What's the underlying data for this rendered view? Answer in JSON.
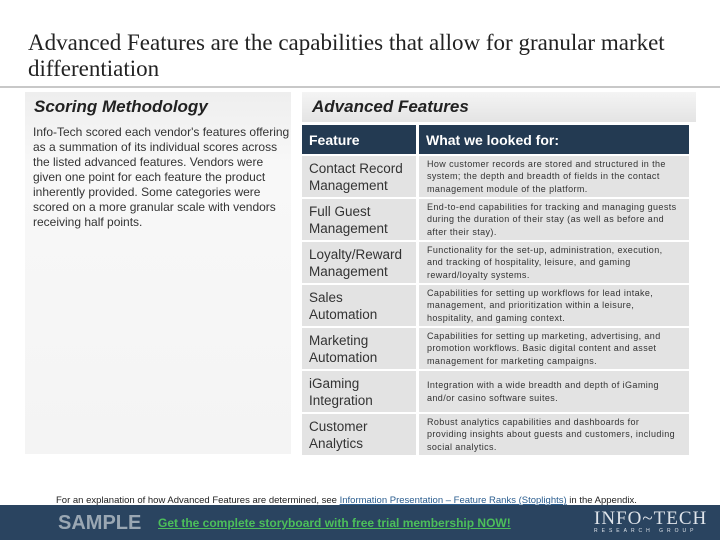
{
  "title": "Advanced Features are the capabilities that allow for granular market differentiation",
  "left": {
    "heading": "Scoring Methodology",
    "body": "Info-Tech scored each vendor's features offering as a summation of its individual scores across the listed advanced features. Vendors were given one point for each feature the product inherently provided. Some categories were scored on a more granular scale with vendors receiving half points."
  },
  "right": {
    "heading": "Advanced Features",
    "col1": "Feature",
    "col2": "What we looked for:",
    "rows": [
      {
        "feature": "Contact Record Management",
        "desc": "How customer records are stored and structured in the system; the depth and breadth of fields in the contact management module of the platform."
      },
      {
        "feature": "Full Guest Management",
        "desc": "End-to-end capabilities for tracking and managing guests during the duration of their stay (as well as before and after their stay)."
      },
      {
        "feature": "Loyalty/Reward Management",
        "desc": "Functionality for the set-up, administration, execution, and tracking of hospitality, leisure, and gaming reward/loyalty systems."
      },
      {
        "feature": "Sales Automation",
        "desc": "Capabilities for setting up workflows for lead intake, management, and prioritization within a leisure, hospitality, and gaming context."
      },
      {
        "feature": "Marketing Automation",
        "desc": "Capabilities for setting up marketing, advertising, and promotion workflows. Basic digital content and asset management for marketing campaigns."
      },
      {
        "feature": "iGaming Integration",
        "desc": "Integration with a wide breadth and depth of iGaming and/or casino software suites."
      },
      {
        "feature": "Customer Analytics",
        "desc": "Robust analytics capabilities and dashboards for providing insights about guests and customers, including social analytics."
      }
    ]
  },
  "footnote": {
    "before": "For an explanation of how Advanced Features are determined, see ",
    "link": "Information Presentation – Feature Ranks (Stoplights)",
    "after": " in the Appendix."
  },
  "banner": {
    "sample": "SAMPLE",
    "cta": "Get the complete storyboard with free trial membership NOW!",
    "logo": "INFO~TECH",
    "logo_sub": "RESEARCH GROUP"
  },
  "colors": {
    "header": "#233a52",
    "banner": "#2a4460",
    "cta": "#4cbf5a"
  }
}
